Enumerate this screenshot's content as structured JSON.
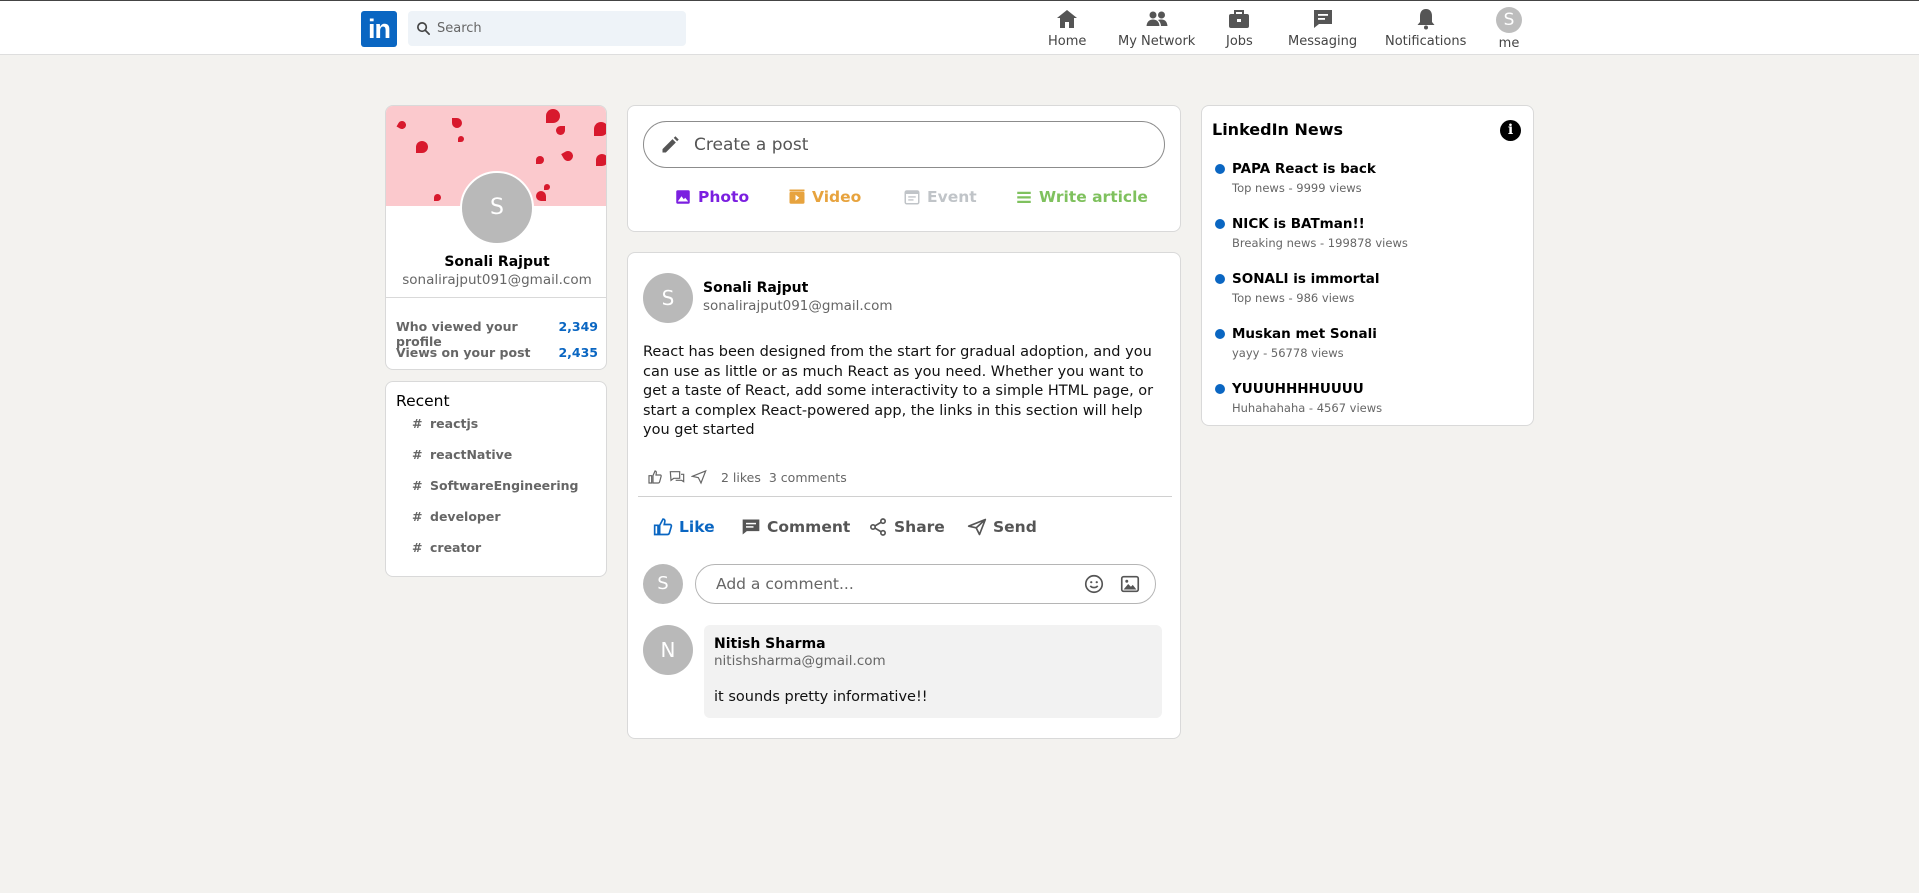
{
  "header": {
    "logo_text": "in",
    "search_placeholder": "Search",
    "nav": [
      {
        "label": "Home",
        "icon": "home-icon"
      },
      {
        "label": "My Network",
        "icon": "network-icon"
      },
      {
        "label": "Jobs",
        "icon": "briefcase-icon"
      },
      {
        "label": "Messaging",
        "icon": "messaging-icon"
      },
      {
        "label": "Notifications",
        "icon": "bell-icon"
      },
      {
        "label": "me",
        "icon": "avatar",
        "avatar_initial": "S"
      }
    ]
  },
  "profile": {
    "avatar_initial": "S",
    "name": "Sonali Rajput",
    "email": "sonalirajput091@gmail.com",
    "stats": [
      {
        "label": "Who viewed your profile",
        "value": "2,349"
      },
      {
        "label": "Views on your post",
        "value": "2,435"
      }
    ]
  },
  "recent": {
    "title": "Recent",
    "hash": "#",
    "tags": [
      "reactjs",
      "reactNative",
      "SoftwareEngineering",
      "developer",
      "creator"
    ]
  },
  "create_post": {
    "placeholder": "Create a post",
    "options": [
      {
        "label": "Photo",
        "color": "#7b1fe0"
      },
      {
        "label": "Video",
        "color": "#e7a33e"
      },
      {
        "label": "Event",
        "color": "#c0c4c8"
      },
      {
        "label": "Write article",
        "color": "#7fc15e"
      }
    ]
  },
  "post": {
    "avatar_initial": "S",
    "author": "Sonali Rajput",
    "email": "sonalirajput091@gmail.com",
    "body": "React has been designed from the start for gradual adoption, and you can use as little or as much React as you need. Whether you want to get a taste of React, add some interactivity to a simple HTML page, or start a complex React-powered app, the links in this section will help you get started",
    "likes": "2 likes",
    "comments": "3 comments",
    "actions": [
      "Like",
      "Comment",
      "Share",
      "Send"
    ],
    "comment_placeholder": "Add a comment...",
    "commenter_initial": "S",
    "reply": {
      "avatar_initial": "N",
      "name": "Nitish Sharma",
      "email": "nitishsharma@gmail.com",
      "text": "it sounds pretty informative!!"
    }
  },
  "news": {
    "title": "LinkedIn News",
    "info_glyph": "i",
    "items": [
      {
        "headline": "PAPA React is back",
        "sub": "Top news - 9999 views"
      },
      {
        "headline": "NICK is BATman!!",
        "sub": "Breaking news - 199878 views"
      },
      {
        "headline": "SONALI is immortal",
        "sub": "Top news - 986 views"
      },
      {
        "headline": "Muskan met Sonali",
        "sub": "yayy - 56778 views"
      },
      {
        "headline": "YUUUHHHHUUUU",
        "sub": "Huhahahaha - 4567 views"
      }
    ]
  },
  "colors": {
    "accent": "#0a66c2",
    "banner": "#fbc9cd",
    "background": "#f3f2ef"
  }
}
